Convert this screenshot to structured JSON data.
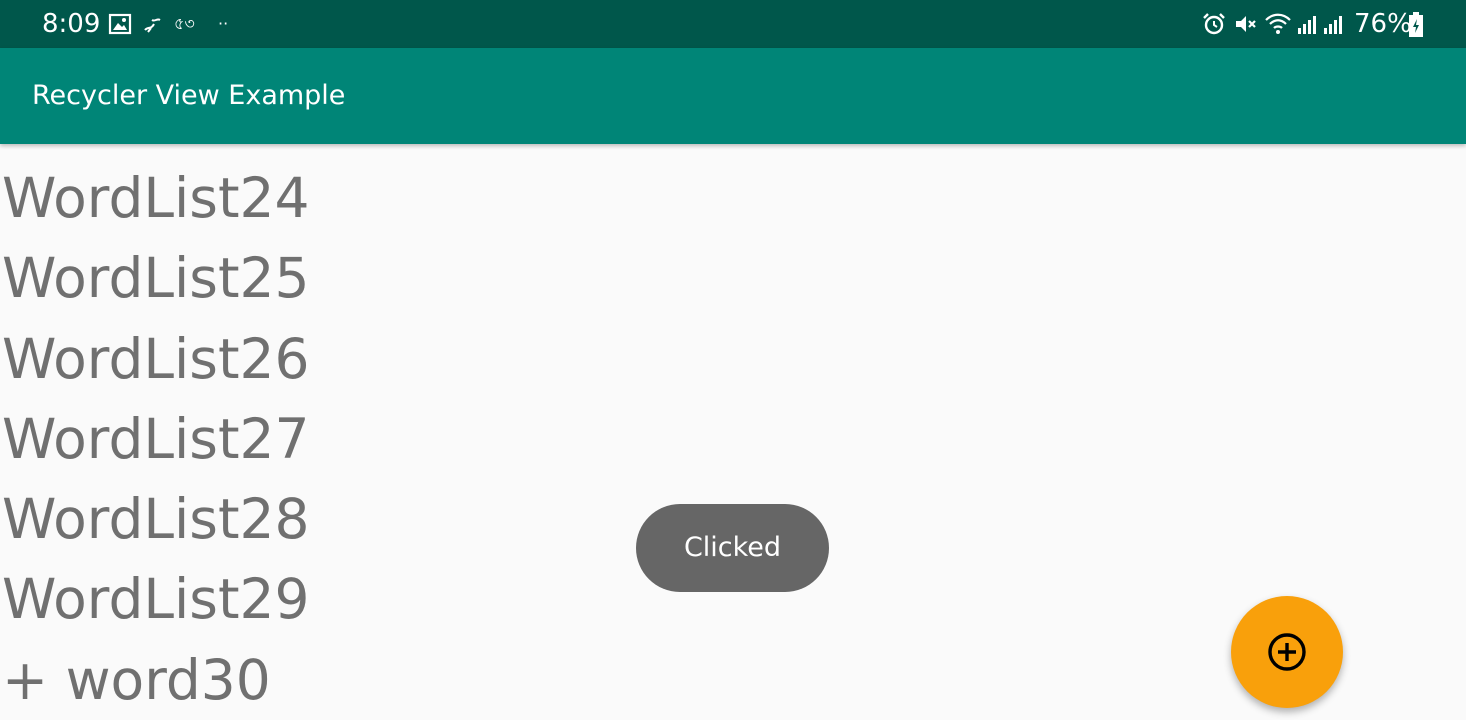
{
  "status_bar": {
    "time": "8:09",
    "extra_text": "৫৩",
    "dots": "··",
    "battery_percent": "76%",
    "icons": [
      "image-icon",
      "notification-icon",
      "alarm-icon",
      "mute-icon",
      "wifi-icon",
      "signal-icon",
      "signal-icon-2",
      "battery-icon"
    ],
    "background_color": "#00574b"
  },
  "app_bar": {
    "title": "Recycler View Example",
    "background_color": "#008577"
  },
  "word_list": {
    "items": [
      "WordList24",
      "WordList25",
      "WordList26",
      "WordList27",
      "WordList28",
      "WordList29",
      "+ word30"
    ],
    "text_color": "#707070"
  },
  "toast": {
    "message": "Clicked",
    "background_color": "#666666"
  },
  "fab": {
    "icon": "add-circle-icon",
    "background_color": "#f9a00b"
  }
}
